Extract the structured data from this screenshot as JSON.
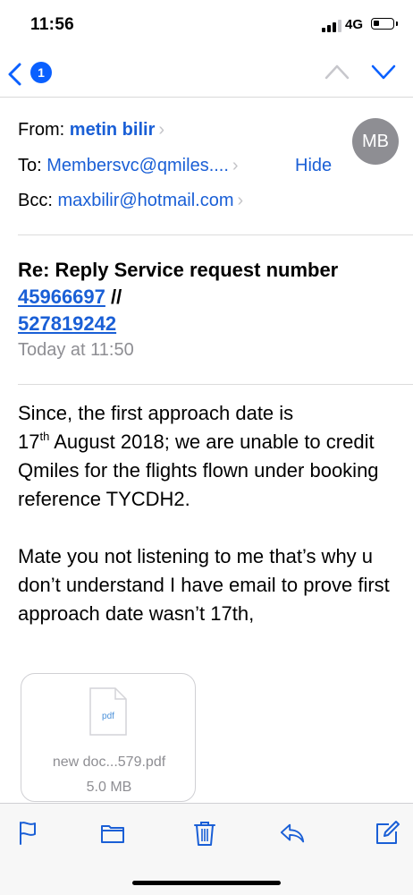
{
  "status_bar": {
    "time": "11:56",
    "network": "4G",
    "battery_level": 0.3,
    "icons": [
      "signal-icon",
      "battery-icon"
    ]
  },
  "nav": {
    "back_icon": "chevron-left-icon",
    "unread_count": "1",
    "prev_icon": "chevron-up-icon",
    "next_icon": "chevron-down-icon"
  },
  "header": {
    "from_label": "From:",
    "from_name": "metin bilir",
    "to_label": "To:",
    "to_value": "Membersvc@qmiles....",
    "hide_label": "Hide",
    "bcc_label": "Bcc:",
    "bcc_value": "maxbilir@hotmail.com",
    "avatar_initials": "MB"
  },
  "subject": {
    "prefix": "Re: Reply Service request number",
    "ref1": "45966697",
    "separator": "//",
    "ref2": "527819242",
    "date": "Today at 11:50"
  },
  "body": {
    "p1_a": "Since, the first approach date is",
    "p1_day": "17",
    "p1_sup": "th",
    "p1_b": " August 2018; we are unable to credit Qmiles for the flights flown under booking reference TYCDH2.",
    "p2": "Mate you not listening to me that’s why u don’t understand I have email to prove first approach date wasn’t 17th,"
  },
  "attachment": {
    "icon_label": "pdf",
    "name": "new doc...579.pdf",
    "size": "5.0 MB"
  },
  "toolbar": {
    "icons": [
      "flag-icon",
      "folder-icon",
      "trash-icon",
      "reply-icon",
      "compose-icon"
    ],
    "accent": "#1a5fd6"
  }
}
